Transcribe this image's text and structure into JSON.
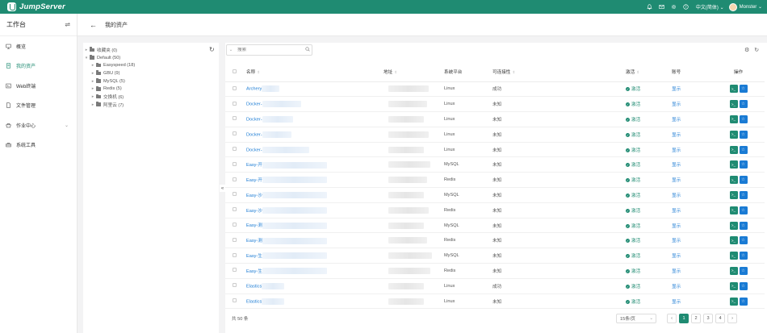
{
  "app": {
    "brand": "JumpServer"
  },
  "topbar": {
    "language": "中文(简体)",
    "user": "Monster"
  },
  "sidebar": {
    "title": "工作台",
    "items": [
      {
        "label": "概览",
        "icon": "monitor-icon"
      },
      {
        "label": "我的资产",
        "icon": "assets-icon"
      },
      {
        "label": "Web终端",
        "icon": "terminal-icon"
      },
      {
        "label": "文件管理",
        "icon": "file-icon"
      },
      {
        "label": "作业中心",
        "icon": "job-icon"
      },
      {
        "label": "系统工具",
        "icon": "toolbox-icon"
      }
    ]
  },
  "header": {
    "title": "我的资产"
  },
  "tree": {
    "nodes": [
      {
        "label": "收藏夹 (0)",
        "level": 0,
        "arrow": "▸"
      },
      {
        "label": "Default (50)",
        "level": 0,
        "arrow": "▾"
      },
      {
        "label": "Easyspeed (18)",
        "level": 1,
        "arrow": "▸"
      },
      {
        "label": "GBU (9)",
        "level": 1,
        "arrow": "▸"
      },
      {
        "label": "MySQL (5)",
        "level": 1,
        "arrow": "▸"
      },
      {
        "label": "Redis (5)",
        "level": 1,
        "arrow": "▸"
      },
      {
        "label": "交换机 (6)",
        "level": 1,
        "arrow": "▸"
      },
      {
        "label": "阿里云 (7)",
        "level": 1,
        "arrow": "▸"
      }
    ]
  },
  "search": {
    "placeholder": "搜索"
  },
  "table": {
    "headers": {
      "name": "名称",
      "address": "地址",
      "platform": "系统平台",
      "connectivity": "可连接性",
      "activate": "激活",
      "account": "账号",
      "actions": "操作"
    },
    "rows": [
      {
        "name": "Archery",
        "platform": "Linux",
        "connectivity": "成功",
        "activate": "激活",
        "account": "显示"
      },
      {
        "name": "Docker-",
        "platform": "Linux",
        "connectivity": "未知",
        "activate": "激活",
        "account": "显示"
      },
      {
        "name": "Docker-",
        "platform": "Linux",
        "connectivity": "未知",
        "activate": "激活",
        "account": "显示"
      },
      {
        "name": "Docker-",
        "platform": "Linux",
        "connectivity": "未知",
        "activate": "激活",
        "account": "显示"
      },
      {
        "name": "Docker-",
        "platform": "Linux",
        "connectivity": "未知",
        "activate": "激活",
        "account": "显示"
      },
      {
        "name": "Easy-开",
        "platform": "MySQL",
        "connectivity": "未知",
        "activate": "激活",
        "account": "显示"
      },
      {
        "name": "Easy-开",
        "platform": "Redis",
        "connectivity": "未知",
        "activate": "激活",
        "account": "显示"
      },
      {
        "name": "Easy-沙",
        "platform": "MySQL",
        "connectivity": "未知",
        "activate": "激活",
        "account": "显示"
      },
      {
        "name": "Easy-沙",
        "platform": "Redis",
        "connectivity": "未知",
        "activate": "激活",
        "account": "显示"
      },
      {
        "name": "Easy-测",
        "platform": "MySQL",
        "connectivity": "未知",
        "activate": "激活",
        "account": "显示"
      },
      {
        "name": "Easy-测",
        "platform": "Redis",
        "connectivity": "未知",
        "activate": "激活",
        "account": "显示"
      },
      {
        "name": "Easy-生",
        "platform": "MySQL",
        "connectivity": "未知",
        "activate": "激活",
        "account": "显示"
      },
      {
        "name": "Easy-生",
        "platform": "Redis",
        "connectivity": "未知",
        "activate": "激活",
        "account": "显示"
      },
      {
        "name": "Elastics",
        "platform": "Linux",
        "connectivity": "成功",
        "activate": "激活",
        "account": "显示"
      },
      {
        "name": "Elastics",
        "platform": "Linux",
        "connectivity": "未知",
        "activate": "激活",
        "account": "显示"
      }
    ]
  },
  "footer": {
    "total": "共 50 条",
    "page_size": "15条/页",
    "pages": [
      "1",
      "2",
      "3",
      "4"
    ],
    "prev": "‹",
    "next": "›"
  },
  "colors": {
    "brand": "#1f8b72",
    "link": "#1a7bd4"
  }
}
